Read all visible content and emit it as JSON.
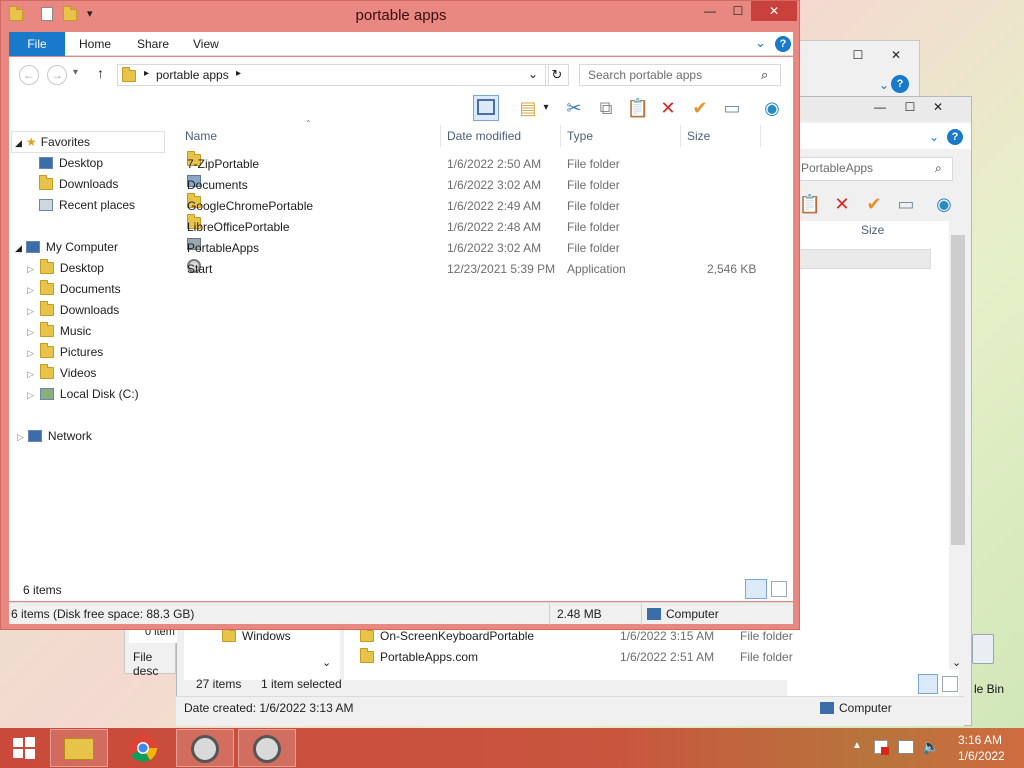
{
  "main_window": {
    "title": "portable apps",
    "ribbon_tabs": [
      "File",
      "Home",
      "Share",
      "View"
    ],
    "address": {
      "segments": [
        "portable apps"
      ]
    },
    "search_placeholder": "Search portable apps",
    "nav": {
      "favorites_label": "Favorites",
      "favorites": [
        "Desktop",
        "Downloads",
        "Recent places"
      ],
      "computer_label": "My Computer",
      "computer": [
        "Desktop",
        "Documents",
        "Downloads",
        "Music",
        "Pictures",
        "Videos",
        "Local Disk (C:)"
      ],
      "network_label": "Network"
    },
    "columns": [
      "Name",
      "Date modified",
      "Type",
      "Size"
    ],
    "files": [
      {
        "name": "7-ZipPortable",
        "date": "1/6/2022 2:50 AM",
        "type": "File folder",
        "size": "",
        "icon": "folder-icon"
      },
      {
        "name": "Documents",
        "date": "1/6/2022 3:02 AM",
        "type": "File folder",
        "size": "",
        "icon": "documents-folder-icon"
      },
      {
        "name": "GoogleChromePortable",
        "date": "1/6/2022 2:49 AM",
        "type": "File folder",
        "size": "",
        "icon": "folder-icon"
      },
      {
        "name": "LibreOfficePortable",
        "date": "1/6/2022 2:48 AM",
        "type": "File folder",
        "size": "",
        "icon": "folder-icon"
      },
      {
        "name": "PortableApps",
        "date": "1/6/2022 3:02 AM",
        "type": "File folder",
        "size": "",
        "icon": "portableapps-folder-icon"
      },
      {
        "name": "Start",
        "date": "12/23/2021 5:39 PM",
        "type": "Application",
        "size": "2,546 KB",
        "icon": "start-app-icon"
      }
    ],
    "item_count": "6 items",
    "status_left": "6 items (Disk free space: 88.3 GB)",
    "status_size": "2.48 MB",
    "status_location": "Computer"
  },
  "back_window": {
    "search_placeholder": "PortableApps",
    "column_size": "Size",
    "nav_item": "Windows",
    "files": [
      {
        "name": "On-ScreenKeyboardPortable",
        "date": "1/6/2022 3:15 AM",
        "type": "File folder"
      },
      {
        "name": "PortableApps.com",
        "date": "1/6/2022 2:51 AM",
        "type": "File folder"
      }
    ],
    "item_count": "27 items",
    "selected": "1 item selected",
    "date_created": "Date created: 1/6/2022 3:13 AM",
    "status_location": "Computer",
    "partial_text_1": "0 item",
    "partial_text_2": "File desc"
  },
  "desktop": {
    "recycle_label": "le Bin"
  },
  "taskbar": {
    "time": "3:16 AM",
    "date": "1/6/2022",
    "colors": {
      "accent": "#1979ca",
      "title_bar": "#e88880",
      "close": "#c9413d"
    }
  }
}
